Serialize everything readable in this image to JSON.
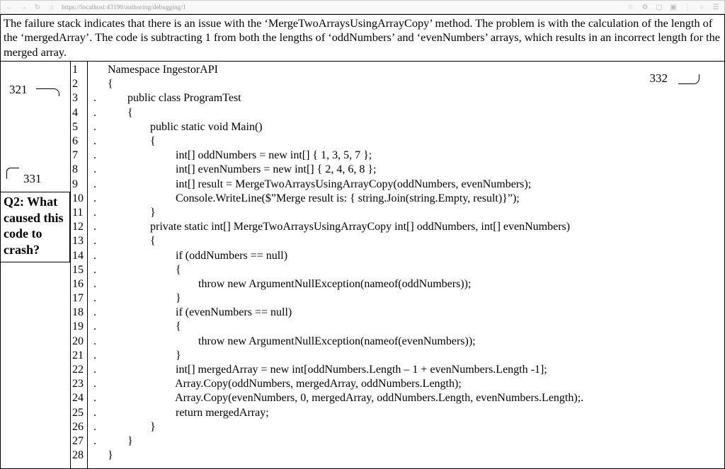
{
  "toolbar": {
    "url": "https://localhost:43190/authoring/debugging/1"
  },
  "top_message": "The failure stack indicates that there is an issue with the ‘MergeTwoArraysUsingArrayCopy’ method. The problem is with the calculation of the length of the ‘mergedArray’. The code is subtracting 1 from both the lengths of ‘oddNumbers’ and ‘evenNumbers’ arrays, which results in an incorrect length for the merged array.",
  "callouts": {
    "c321": "321",
    "c331": "331",
    "c332": "332"
  },
  "question": "Q2: What caused this code to crash?",
  "code": {
    "line_numbers": [
      "1",
      "2",
      "3",
      "4",
      "5",
      "6",
      "7",
      "8",
      "9",
      "10",
      "11",
      "12",
      "13",
      "14",
      "15",
      "16",
      "17",
      "18",
      "19",
      "20",
      "21",
      "22",
      "23",
      "24",
      "25",
      "26",
      "27",
      "28"
    ],
    "lines": [
      "       Namespace IngestorAPI",
      "       {",
      "  .           public class ProgramTest",
      "  .           {",
      "  .                   public static void Main()",
      "  .                   {",
      "  .                            int[] oddNumbers = new int[] { 1, 3, 5, 7 };",
      "  .                            int[] evenNumbers = new int[] { 2, 4, 6, 8 };",
      "  .                            int[] result = MergeTwoArraysUsingArrayCopy(oddNumbers, evenNumbers);",
      "  .                            Console.WriteLine($”Merge result is: { string.Join(string.Empty, result)}”);",
      "  .                   }",
      "  .                   private static int[] MergeTwoArraysUsingArrayCopy int[] oddNumbers, int[] evenNumbers)",
      "  .                   {",
      "  .                            if (oddNumbers == null)",
      "  .                            {",
      "  .                                    throw new ArgumentNullException(nameof(oddNumbers));",
      "  .                            }",
      "  .                            if (evenNumbers == null)",
      "  .                            {",
      "  .                                    throw new ArgumentNullException(nameof(evenNumbers));",
      "  .                            }",
      "  .                            int[] mergedArray = new int[oddNumbers.Length – 1 + evenNumbers.Length -1];",
      "  .                            Array.Copy(oddNumbers, mergedArray, oddNumbers.Length);",
      "  .                            Array.Copy(evenNumbers, 0, mergedArray, oddNumbers.Length, evenNumbers.Length);.",
      "  .                            return mergedArray;",
      "  .                   }",
      "  .           }",
      "       }"
    ]
  }
}
